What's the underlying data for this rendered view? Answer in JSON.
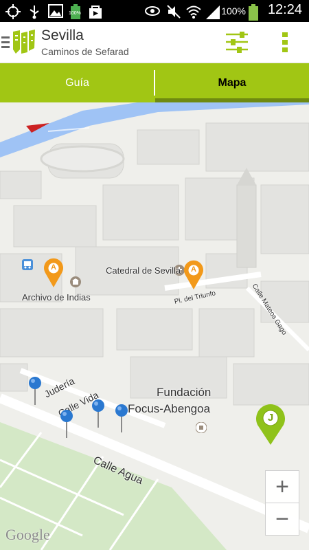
{
  "status_bar": {
    "battery_percent": "100%",
    "time": "12:24",
    "small_badge": "100%"
  },
  "action_bar": {
    "title": "Sevilla",
    "subtitle": "Caminos de Sefarad"
  },
  "tabs": [
    {
      "label": "Guía",
      "selected": false
    },
    {
      "label": "Mapa",
      "selected": true
    }
  ],
  "map": {
    "labels": {
      "catedral": "Catedral de Sevilla",
      "archivo": "Archivo de Indias",
      "fundacion_line1": "Fundación",
      "fundacion_line2": "Focus-Abengoa",
      "judieria": "Judería",
      "calle_vida": "Calle Vida",
      "calle_agua": "Calle Agua",
      "calle_mateos": "Calle Mateos Gago",
      "pl_triunfo": "Pl. del Triunfo",
      "google": "Google"
    },
    "markers": {
      "orange_letter": "A",
      "green_letter": "J"
    },
    "zoom_in": "+",
    "zoom_out": "−"
  },
  "colors": {
    "accent": "#a1c614",
    "marker_orange": "#f2991a",
    "marker_blue": "#2a78d0"
  }
}
